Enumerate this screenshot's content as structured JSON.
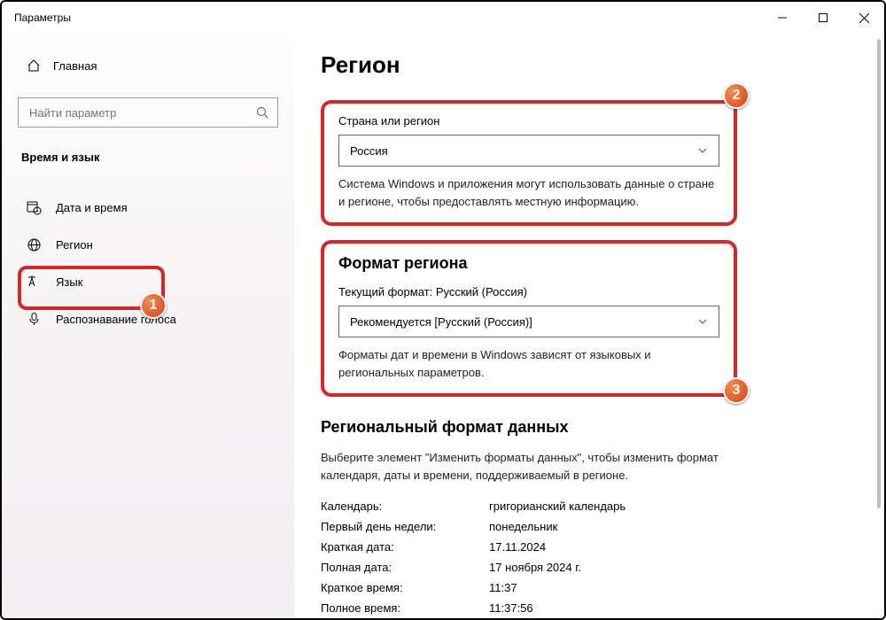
{
  "window": {
    "title": "Параметры"
  },
  "sidebar": {
    "home": "Главная",
    "search_placeholder": "Найти параметр",
    "category": "Время и язык",
    "items": [
      {
        "label": "Дата и время"
      },
      {
        "label": "Регион"
      },
      {
        "label": "Язык"
      },
      {
        "label": "Распознавание голоса"
      }
    ]
  },
  "page": {
    "heading": "Регион",
    "country": {
      "label": "Страна или регион",
      "value": "Россия",
      "desc": "Система Windows и приложения могут использовать данные о стране и регионе, чтобы предоставлять местную информацию."
    },
    "format": {
      "heading": "Формат региона",
      "current": "Текущий формат: Русский (Россия)",
      "value": "Рекомендуется [Русский (Россия)]",
      "desc": "Форматы дат и времени в Windows зависят от языковых и региональных параметров."
    },
    "regional": {
      "heading": "Региональный формат данных",
      "desc": "Выберите элемент \"Изменить форматы данных\", чтобы изменить формат календаря, даты и времени, поддерживаемый в регионе.",
      "rows": [
        {
          "k": "Календарь:",
          "v": "григорианский календарь"
        },
        {
          "k": "Первый день недели:",
          "v": "понедельник"
        },
        {
          "k": "Краткая дата:",
          "v": "17.11.2024"
        },
        {
          "k": "Полная дата:",
          "v": "17 ноября 2024 г."
        },
        {
          "k": "Краткое время:",
          "v": "11:37"
        },
        {
          "k": "Полное время:",
          "v": "11:37:56"
        }
      ]
    }
  },
  "annotations": {
    "b1": "1",
    "b2": "2",
    "b3": "3"
  }
}
